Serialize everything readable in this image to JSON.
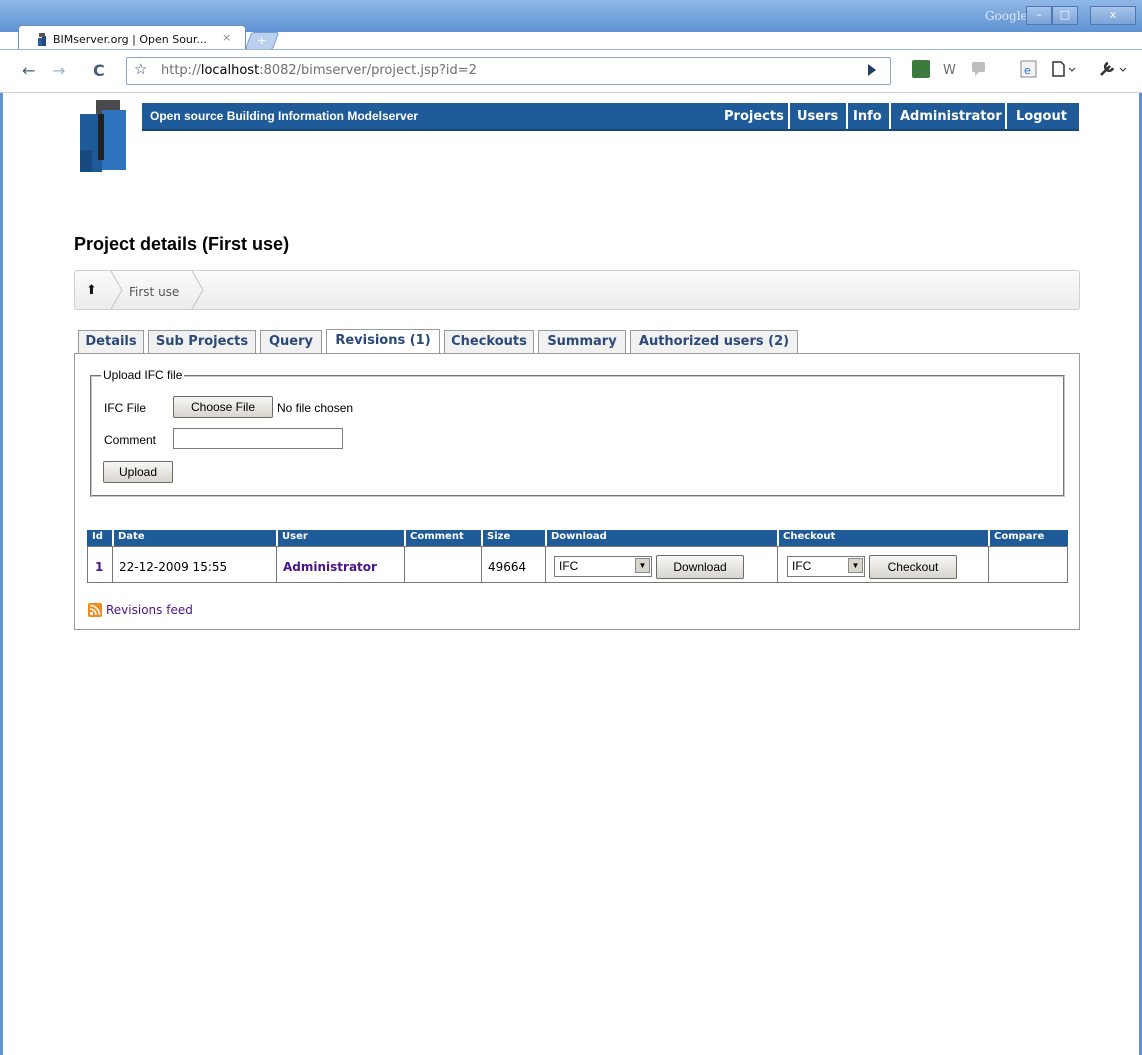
{
  "browser": {
    "tab_title": "BIMserver.org | Open Sour...",
    "tab_close": "×",
    "new_tab": "+",
    "brand": "Google",
    "window_controls": [
      "–",
      "□",
      "x"
    ],
    "url_prefix": "http://",
    "url_host": "localhost",
    "url_rest": ":8082/bimserver/project.jsp?id=2"
  },
  "site": {
    "title": "Open source Building Information Modelserver",
    "nav": [
      "Projects",
      "Users",
      "Info",
      "Administrator",
      "Logout"
    ]
  },
  "page": {
    "title": "Project details (First use)",
    "breadcrumb": "First use"
  },
  "tabs": [
    "Details",
    "Sub Projects",
    "Query",
    "Revisions (1)",
    "Checkouts",
    "Summary",
    "Authorized users (2)"
  ],
  "upload": {
    "legend": "Upload IFC file",
    "file_label": "IFC File",
    "choose_label": "Choose File",
    "no_file": "No file chosen",
    "comment_label": "Comment",
    "comment_value": "",
    "upload_label": "Upload"
  },
  "table": {
    "headers": [
      "Id",
      "Date",
      "User",
      "Comment",
      "Size",
      "Download",
      "Checkout",
      "Compare"
    ],
    "row": {
      "id": "1",
      "date": "22-12-2009 15:55",
      "user": "Administrator",
      "comment": "",
      "size": "49664",
      "download_format": "IFC",
      "download_label": "Download",
      "checkout_format": "IFC",
      "checkout_label": "Checkout"
    }
  },
  "feed": {
    "label": "Revisions feed"
  },
  "colors": {
    "brand_blue": "#1f5a99",
    "link_purple": "#4a148c",
    "feed_orange": "#f28a1f"
  }
}
